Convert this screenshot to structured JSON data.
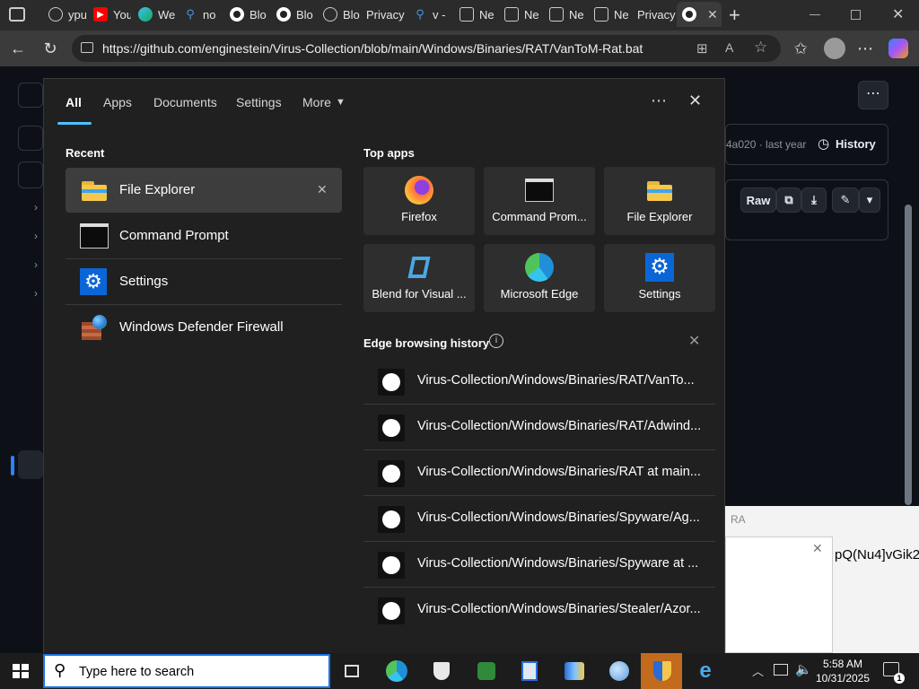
{
  "browser": {
    "tabs": [
      {
        "label": "ypu",
        "icon": "globe-icon"
      },
      {
        "label": "You",
        "icon": "youtube-icon"
      },
      {
        "label": "We",
        "icon": "edge-icon"
      },
      {
        "label": "no",
        "icon": "search-icon"
      },
      {
        "label": "Blo",
        "icon": "github-icon"
      },
      {
        "label": "Blo",
        "icon": "github-icon"
      },
      {
        "label": "Blo",
        "icon": "globe-icon"
      },
      {
        "label": "Privacy",
        "icon": "globe-icon"
      },
      {
        "label": "v -",
        "icon": "search-icon"
      },
      {
        "label": "Ne",
        "icon": "newtab-icon"
      },
      {
        "label": "Ne",
        "icon": "newtab-icon"
      },
      {
        "label": "Ne",
        "icon": "newtab-icon"
      },
      {
        "label": "Ne",
        "icon": "newtab-icon"
      },
      {
        "label": "Privacy",
        "icon": "globe-icon"
      }
    ],
    "url": "https://github.com/enginestein/Virus-Collection/blob/main/Windows/Binaries/RAT/VanToM-Rat.bat"
  },
  "github": {
    "commit_info": "4a020 · last year",
    "history_label": "History",
    "raw_label": "Raw",
    "background_text": "pQ(Nu4]vGik2",
    "background_caption": "RA"
  },
  "search_panel": {
    "tabs": {
      "all": "All",
      "apps": "Apps",
      "documents": "Documents",
      "settings": "Settings",
      "more": "More"
    },
    "recent_title": "Recent",
    "recent": [
      {
        "label": "File Explorer",
        "icon": "folder-icon"
      },
      {
        "label": "Command Prompt",
        "icon": "terminal-icon"
      },
      {
        "label": "Settings",
        "icon": "gear-icon"
      },
      {
        "label": "Windows Defender Firewall",
        "icon": "firewall-icon"
      }
    ],
    "top_apps_title": "Top apps",
    "top_apps": [
      {
        "label": "Firefox",
        "icon": "firefox-icon"
      },
      {
        "label": "Command Prom...",
        "icon": "terminal-icon"
      },
      {
        "label": "File Explorer",
        "icon": "folder-icon"
      },
      {
        "label": "Blend for Visual ...",
        "icon": "blend-icon"
      },
      {
        "label": "Microsoft Edge",
        "icon": "edge-icon"
      },
      {
        "label": "Settings",
        "icon": "gear-icon"
      }
    ],
    "history_title": "Edge browsing history",
    "history": [
      {
        "label": "Virus-Collection/Windows/Binaries/RAT/VanTo..."
      },
      {
        "label": "Virus-Collection/Windows/Binaries/RAT/Adwind..."
      },
      {
        "label": "Virus-Collection/Windows/Binaries/RAT at main..."
      },
      {
        "label": "Virus-Collection/Windows/Binaries/Spyware/Ag..."
      },
      {
        "label": "Virus-Collection/Windows/Binaries/Spyware at ..."
      },
      {
        "label": "Virus-Collection/Windows/Binaries/Stealer/Azor..."
      }
    ]
  },
  "taskbar": {
    "search_placeholder": "Type here to search",
    "time": "5:58 AM",
    "date": "10/31/2025",
    "notification_count": "1"
  },
  "colors": {
    "accent": "#4cc2ff",
    "panel": "#202020",
    "tile": "#2e2e2e",
    "selected": "#3d3d3d"
  }
}
